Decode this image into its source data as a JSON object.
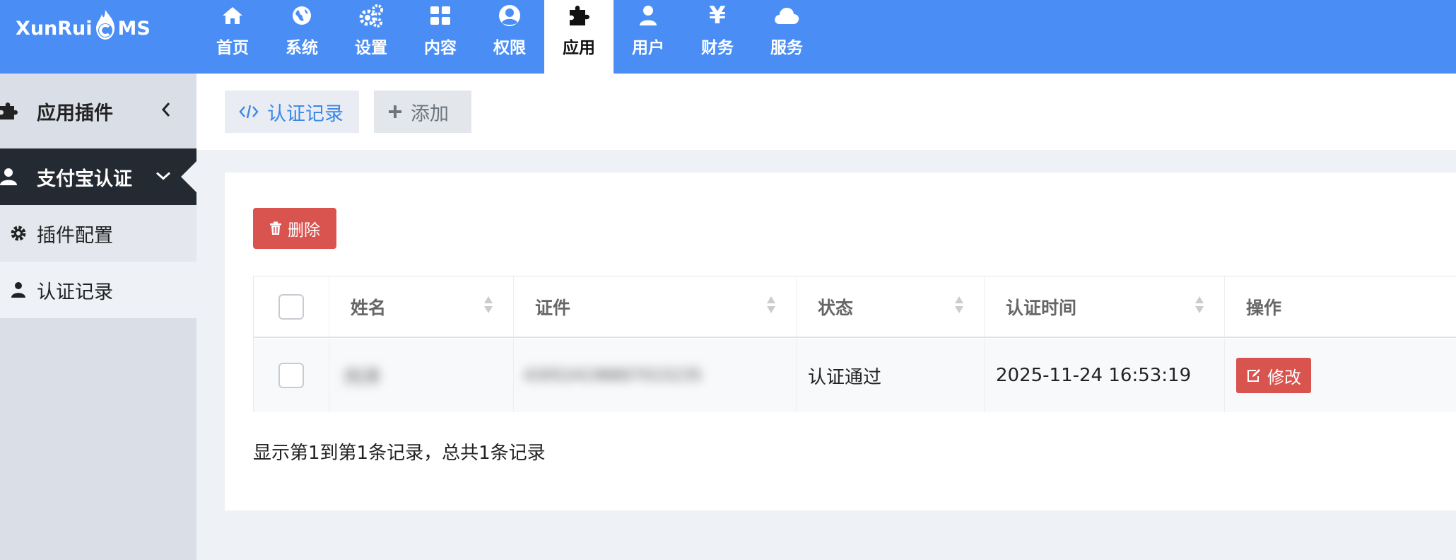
{
  "logo": {
    "text_before": "XunRui",
    "text_after": "MS"
  },
  "nav": [
    {
      "label": "首页",
      "icon": "home-icon"
    },
    {
      "label": "系统",
      "icon": "globe-icon"
    },
    {
      "label": "设置",
      "icon": "gears-icon"
    },
    {
      "label": "内容",
      "icon": "grid-icon"
    },
    {
      "label": "权限",
      "icon": "user-circle-icon"
    },
    {
      "label": "应用",
      "icon": "puzzle-icon",
      "active": true
    },
    {
      "label": "用户",
      "icon": "user-icon"
    },
    {
      "label": "财务",
      "icon": "yen-icon"
    },
    {
      "label": "服务",
      "icon": "cloud-icon"
    }
  ],
  "nav_yen_glyph": "¥",
  "sidebar": {
    "group1": {
      "label": "应用插件",
      "icon": "puzzle-icon"
    },
    "group2": {
      "label": "支付宝认证",
      "icon": "user-icon"
    },
    "sub1": {
      "label": "插件配置",
      "icon": "gear-icon"
    },
    "sub2": {
      "label": "认证记录",
      "icon": "user-icon"
    }
  },
  "tabs": {
    "records": {
      "label": "认证记录",
      "icon": "code-icon"
    },
    "add": {
      "label": "添加",
      "icon": "plus-icon"
    }
  },
  "toolbar": {
    "delete_label": "删除"
  },
  "table": {
    "headers": [
      "姓名",
      "证件",
      "状态",
      "认证时间",
      "操作"
    ],
    "rows": [
      {
        "name": "刘洋",
        "id_number": "430524198807015235",
        "status": "认证通过",
        "time": "2025-11-24 16:53:19",
        "action": "修改"
      }
    ]
  },
  "summary": "显示第1到第1条记录，总共1条记录",
  "colors": {
    "topbar": "#4a8ef5",
    "sidebar_active": "#242a31",
    "danger": "#d9534f",
    "link": "#3a86e8"
  }
}
